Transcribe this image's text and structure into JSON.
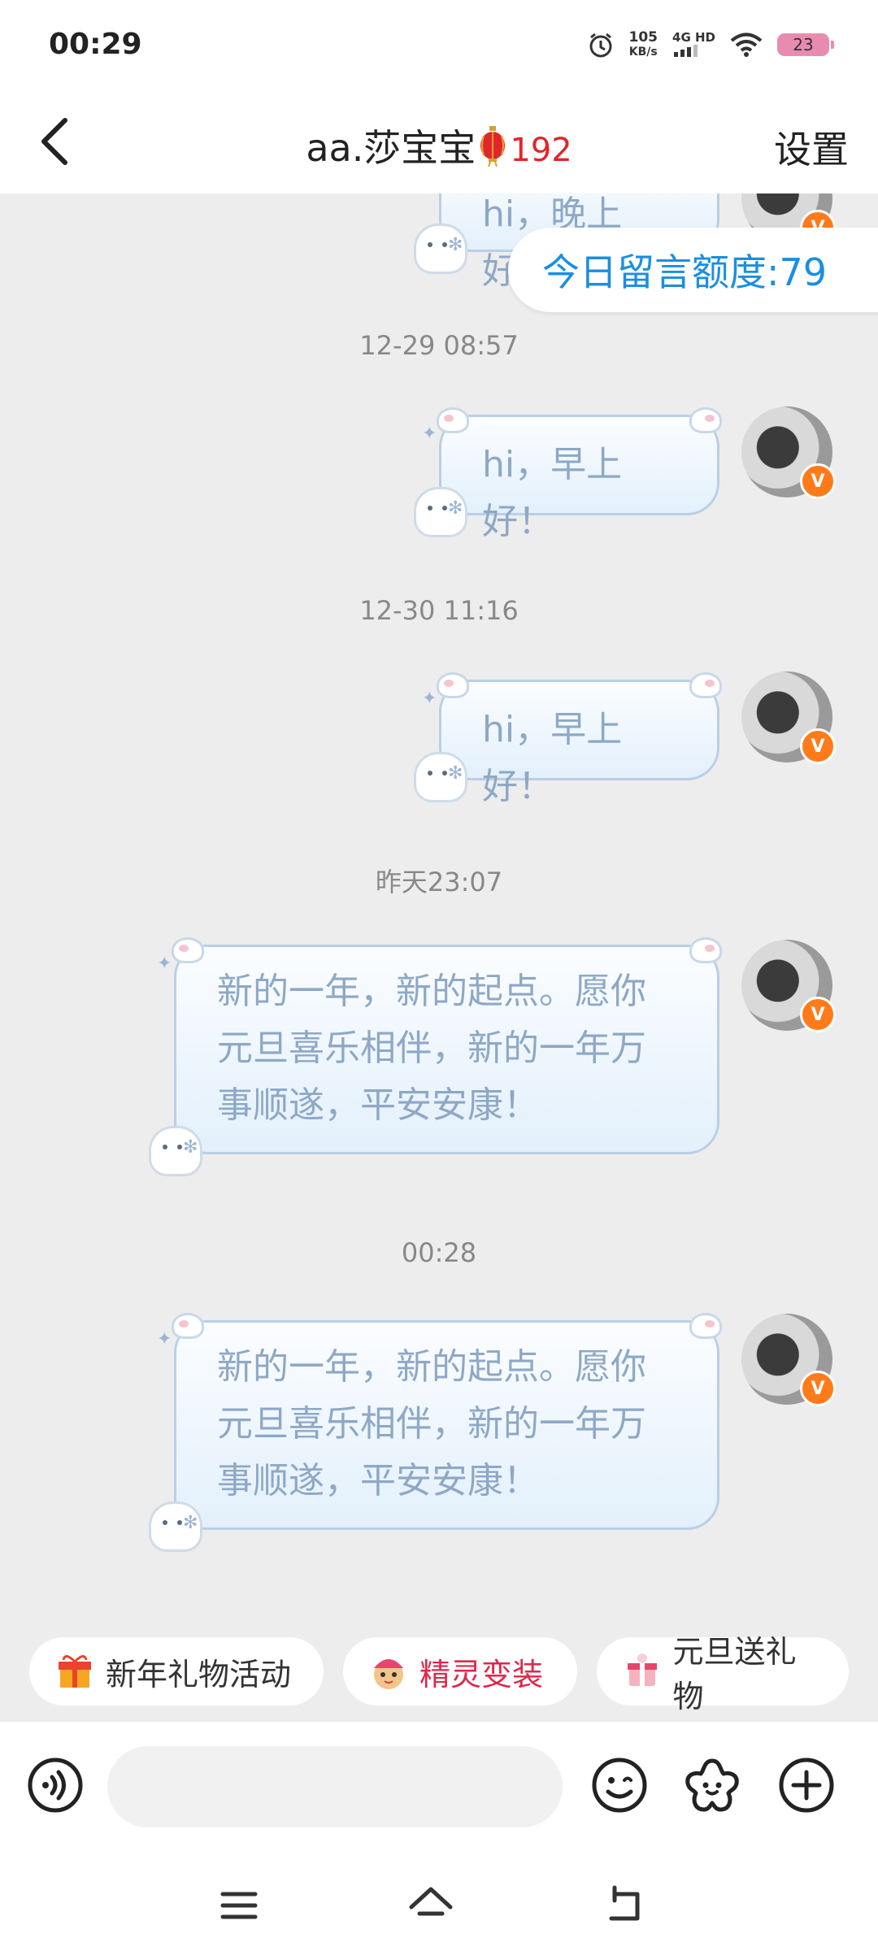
{
  "status_bar": {
    "time": "00:29",
    "speed_value": "105",
    "speed_unit": "KB/s",
    "network": "4G HD",
    "battery": "23"
  },
  "header": {
    "title": "aa.莎宝宝",
    "count": "192",
    "settings_label": "设置"
  },
  "quota_label": "今日留言额度:79",
  "messages": [
    {
      "text": "hi，晚上好！"
    },
    {
      "timestamp": "12-29 08:57",
      "text": "hi，早上好！"
    },
    {
      "timestamp": "12-30 11:16",
      "text": "hi，早上好！"
    },
    {
      "timestamp": "昨天23:07",
      "lines": [
        "新的一年，新的起点。愿你",
        "元旦喜乐相伴，新的一年万",
        "事顺遂，平安安康！"
      ]
    },
    {
      "timestamp": "00:28",
      "lines": [
        "新的一年，新的起点。愿你",
        "元旦喜乐相伴，新的一年万",
        "事顺遂，平安安康！"
      ]
    }
  ],
  "chips": [
    {
      "label": "新年礼物活动",
      "icon": "gift-icon"
    },
    {
      "label": "精灵变装",
      "icon": "sprite-icon"
    },
    {
      "label": "元旦送礼物",
      "icon": "new-year-gift-icon"
    }
  ],
  "input": {
    "placeholder": ""
  },
  "colors": {
    "accent_blue": "#1a8fe0",
    "count_red": "#e0262b",
    "chip_red": "#e0264a",
    "bubble_text": "#8ea8c6",
    "verified_orange": "#ff7b1a"
  },
  "icons": {
    "back": "chevron-left-icon",
    "voice": "voice-icon",
    "emoji": "emoji-icon",
    "sticker": "flower-sticker-icon",
    "plus": "plus-icon",
    "nav_menu": "menu-icon",
    "nav_home": "home-icon",
    "nav_back": "back-arrow-icon"
  }
}
